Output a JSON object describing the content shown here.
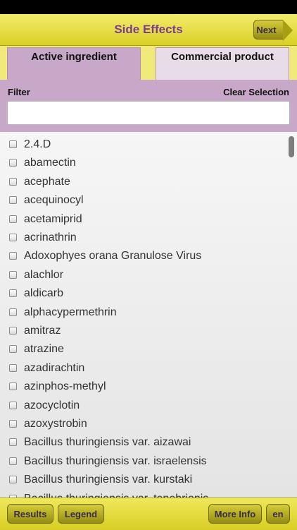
{
  "header": {
    "title": "Side Effects",
    "next_label": "Next"
  },
  "tabs": [
    {
      "label": "Active ingredient",
      "active": true
    },
    {
      "label": "Commercial product",
      "active": false
    }
  ],
  "filter": {
    "label": "Filter",
    "clear_label": "Clear Selection",
    "value": "",
    "placeholder": ""
  },
  "items": [
    "2.4.D",
    "abamectin",
    "acephate",
    "acequinocyl",
    "acetamiprid",
    "acrinathrin",
    "Adoxophyes orana Granulose Virus",
    "alachlor",
    "aldicarb",
    "alphacypermethrin",
    "amitraz",
    "atrazine",
    "azadirachtin",
    "azinphos-methyl",
    "azocyclotin",
    "azoxystrobin",
    "Bacillus thuringiensis var. aizawai",
    "Bacillus thuringiensis var. israelensis",
    "Bacillus thuringiensis var. kurstaki",
    "Bacillus thuringiensis var. tenebrionis"
  ],
  "footer": {
    "results_label": "Results",
    "legend_label": "Legend",
    "more_info_label": "More Info",
    "lang_label": "en"
  },
  "colors": {
    "header_yellow": "#e6dc3a",
    "tab_purple": "#c8a8c8",
    "title_purple": "#7a3d8c"
  }
}
